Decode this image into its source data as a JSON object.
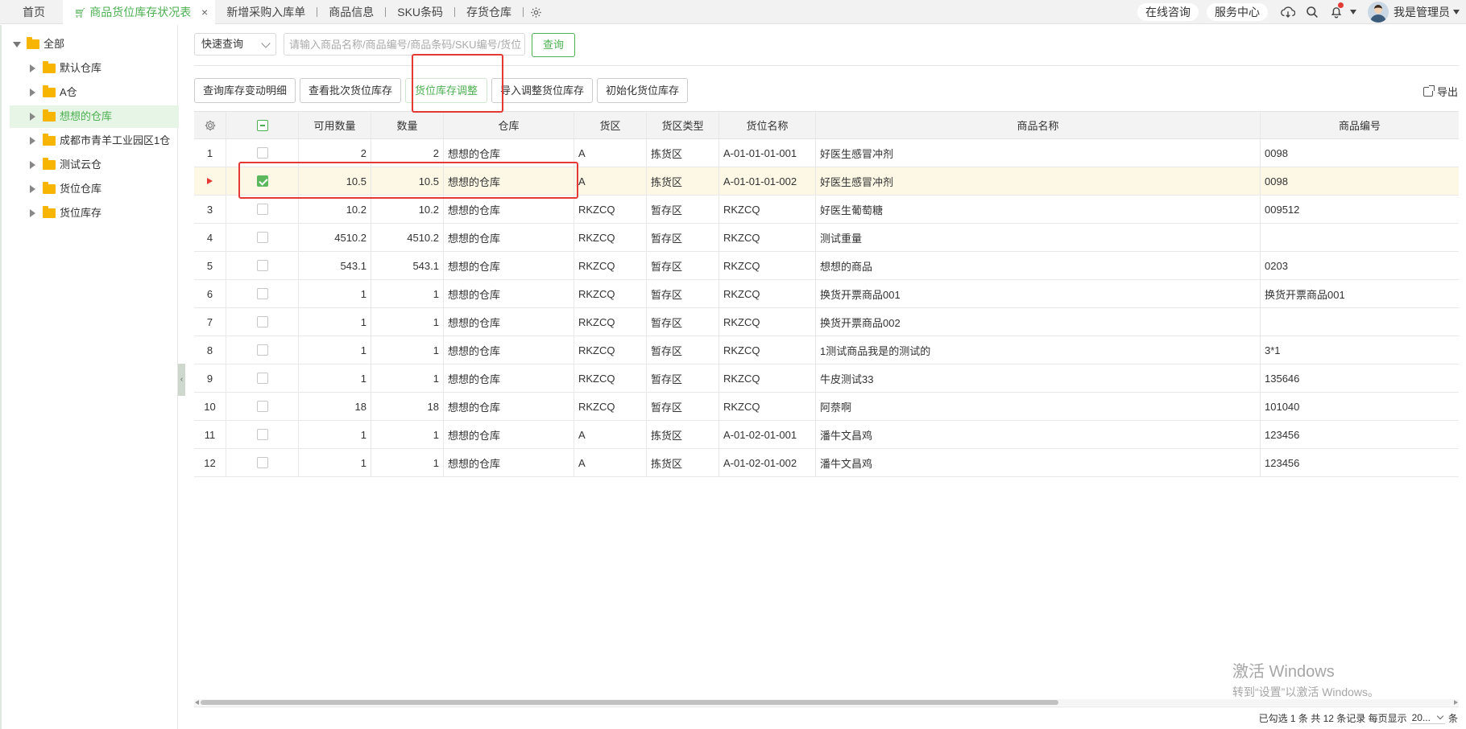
{
  "tabs": [
    {
      "label": "首页",
      "active": false
    },
    {
      "label": "商品货位库存状况表",
      "active": true
    },
    {
      "label": "新增采购入库单",
      "active": false
    },
    {
      "label": "商品信息",
      "active": false
    },
    {
      "label": "SKU条码",
      "active": false
    },
    {
      "label": "存货仓库",
      "active": false
    }
  ],
  "tab_close_glyph": "×",
  "header_right": {
    "online_consult": "在线咨询",
    "service_center": "服务中心",
    "user_name": "我是管理员"
  },
  "tree": {
    "root": "全部",
    "items": [
      {
        "label": "默认仓库",
        "selected": false
      },
      {
        "label": "A仓",
        "selected": false
      },
      {
        "label": "想想的仓库",
        "selected": true
      },
      {
        "label": "成都市青羊工业园区1仓",
        "selected": false
      },
      {
        "label": "测试云仓",
        "selected": false
      },
      {
        "label": "货位仓库",
        "selected": false
      },
      {
        "label": "货位库存",
        "selected": false
      }
    ],
    "collapse_glyph": "‹"
  },
  "search": {
    "mode": "快速查询",
    "placeholder": "请输入商品名称/商品编号/商品条码/SKU编号/货位",
    "button": "查询"
  },
  "toolbar": {
    "query_changes": "查询库存变动明细",
    "view_batch": "查看批次货位库存",
    "adjust": "货位库存调整",
    "import_adjust": "导入调整货位库存",
    "init": "初始化货位库存",
    "export": "导出"
  },
  "table": {
    "columns": [
      "可用数量",
      "数量",
      "仓库",
      "货区",
      "货区类型",
      "货位名称",
      "商品名称",
      "商品编号"
    ],
    "rows": [
      {
        "no": "1",
        "avail": "2",
        "qty": "2",
        "warehouse": "想想的仓库",
        "zone": "A",
        "zone_type": "拣货区",
        "location": "A-01-01-01-001",
        "product": "好医生感冒冲剂",
        "code": "0098",
        "checked": false,
        "current": false
      },
      {
        "no": "",
        "avail": "10.5",
        "qty": "10.5",
        "warehouse": "想想的仓库",
        "zone": "A",
        "zone_type": "拣货区",
        "location": "A-01-01-01-002",
        "product": "好医生感冒冲剂",
        "code": "0098",
        "checked": true,
        "current": true
      },
      {
        "no": "3",
        "avail": "10.2",
        "qty": "10.2",
        "warehouse": "想想的仓库",
        "zone": "RKZCQ",
        "zone_type": "暂存区",
        "location": "RKZCQ",
        "product": "好医生葡萄糖",
        "code": "009512",
        "checked": false,
        "current": false
      },
      {
        "no": "4",
        "avail": "4510.2",
        "qty": "4510.2",
        "warehouse": "想想的仓库",
        "zone": "RKZCQ",
        "zone_type": "暂存区",
        "location": "RKZCQ",
        "product": "测试重量",
        "code": "",
        "checked": false,
        "current": false
      },
      {
        "no": "5",
        "avail": "543.1",
        "qty": "543.1",
        "warehouse": "想想的仓库",
        "zone": "RKZCQ",
        "zone_type": "暂存区",
        "location": "RKZCQ",
        "product": "想想的商品",
        "code": "0203",
        "checked": false,
        "current": false
      },
      {
        "no": "6",
        "avail": "1",
        "qty": "1",
        "warehouse": "想想的仓库",
        "zone": "RKZCQ",
        "zone_type": "暂存区",
        "location": "RKZCQ",
        "product": "换货开票商品001",
        "code": "换货开票商品001",
        "checked": false,
        "current": false
      },
      {
        "no": "7",
        "avail": "1",
        "qty": "1",
        "warehouse": "想想的仓库",
        "zone": "RKZCQ",
        "zone_type": "暂存区",
        "location": "RKZCQ",
        "product": "换货开票商品002",
        "code": "",
        "checked": false,
        "current": false
      },
      {
        "no": "8",
        "avail": "1",
        "qty": "1",
        "warehouse": "想想的仓库",
        "zone": "RKZCQ",
        "zone_type": "暂存区",
        "location": "RKZCQ",
        "product": "1测试商品我是的测试的",
        "code": "3*1",
        "checked": false,
        "current": false
      },
      {
        "no": "9",
        "avail": "1",
        "qty": "1",
        "warehouse": "想想的仓库",
        "zone": "RKZCQ",
        "zone_type": "暂存区",
        "location": "RKZCQ",
        "product": "牛皮测试33",
        "code": "135646",
        "checked": false,
        "current": false
      },
      {
        "no": "10",
        "avail": "18",
        "qty": "18",
        "warehouse": "想想的仓库",
        "zone": "RKZCQ",
        "zone_type": "暂存区",
        "location": "RKZCQ",
        "product": "阿萘啊",
        "code": "101040",
        "checked": false,
        "current": false
      },
      {
        "no": "11",
        "avail": "1",
        "qty": "1",
        "warehouse": "想想的仓库",
        "zone": "A",
        "zone_type": "拣货区",
        "location": "A-01-02-01-001",
        "product": "潘牛文昌鸡",
        "code": "123456",
        "checked": false,
        "current": false
      },
      {
        "no": "12",
        "avail": "1",
        "qty": "1",
        "warehouse": "想想的仓库",
        "zone": "A",
        "zone_type": "拣货区",
        "location": "A-01-02-01-002",
        "product": "潘牛文昌鸡",
        "code": "123456",
        "checked": false,
        "current": false
      }
    ]
  },
  "status": {
    "summary": "已勾选 1 条 共 12 条记录 每页显示",
    "page_size": "20...",
    "unit": "条"
  },
  "watermark": {
    "line1": "激活 Windows",
    "line2": "转到“设置”以激活 Windows。"
  },
  "colors": {
    "accent": "#4caf50",
    "highlight_row": "#fdf8e5",
    "annotation": "#e53935"
  }
}
